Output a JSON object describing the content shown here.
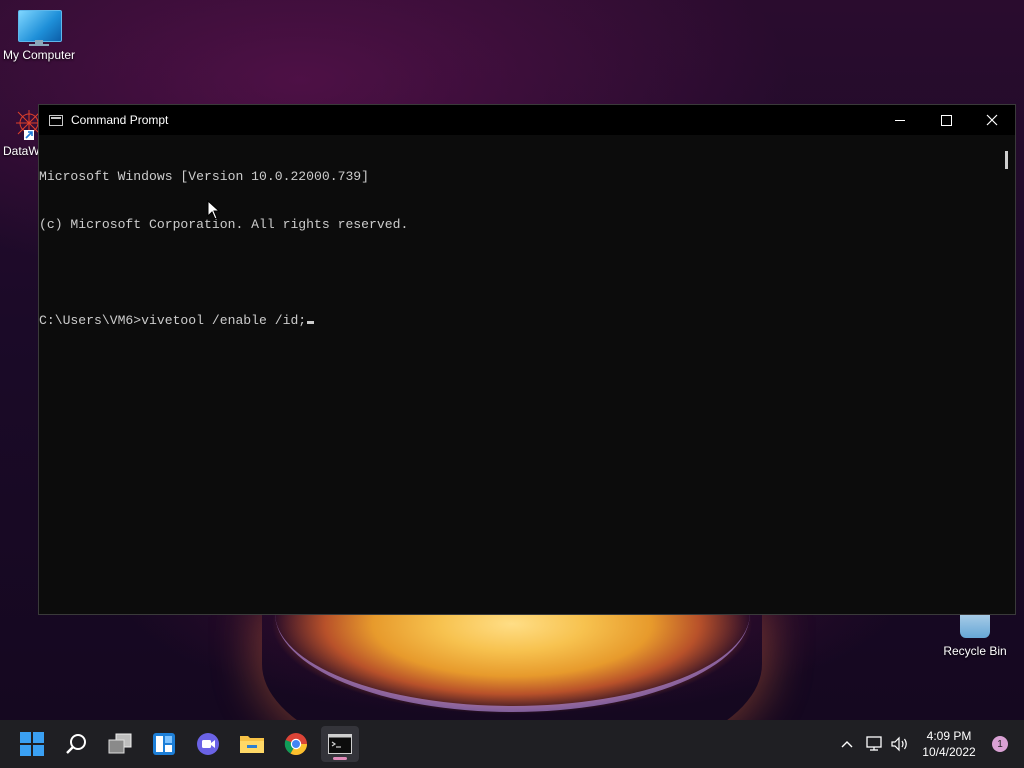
{
  "desktop": {
    "icons": {
      "my_computer": "My Computer",
      "dataw": "DataW",
      "recycle_bin": "Recycle Bin"
    }
  },
  "window": {
    "title": "Command Prompt",
    "lines": [
      "Microsoft Windows [Version 10.0.22000.739]",
      "(c) Microsoft Corporation. All rights reserved.",
      "",
      "C:\\Users\\VM6>vivetool /enable /id;"
    ]
  },
  "taskbar": {
    "apps": [
      "start-icon",
      "search-icon",
      "task-view-icon",
      "widgets-icon",
      "chat-icon",
      "file-explorer-icon",
      "chrome-icon",
      "terminal-icon"
    ],
    "clock": {
      "time": "4:09 PM",
      "date": "10/4/2022"
    },
    "notification_count": "1"
  },
  "colors": {
    "taskbar_bg": "#1f1f23",
    "console_bg": "#0c0c0c",
    "console_text": "#cccccc",
    "accent": "#0078d4"
  }
}
